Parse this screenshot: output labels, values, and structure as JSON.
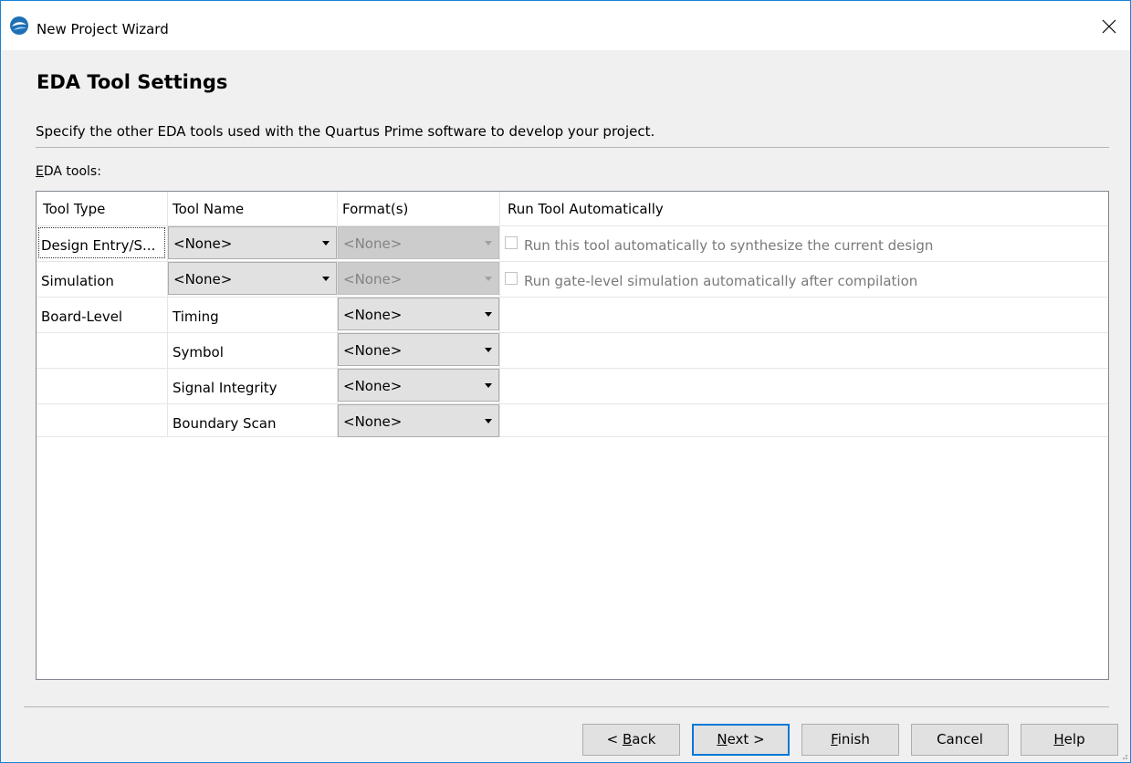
{
  "window": {
    "title": "New Project Wizard",
    "close_label": "Close"
  },
  "page": {
    "heading": "EDA Tool Settings",
    "description": "Specify the other EDA tools used with the Quartus Prime software to develop your project.",
    "eda_tools_label_mnemonic": "E",
    "eda_tools_label_rest": "DA tools:"
  },
  "table": {
    "headers": [
      "Tool Type",
      "Tool Name",
      "Format(s)",
      "Run Tool Automatically"
    ],
    "rows": [
      {
        "tool_type": "Design Entry/S...",
        "tool_name": "<None>",
        "tool_name_is_dropdown": true,
        "format": "<None>",
        "format_enabled": false,
        "run_label": "Run this tool automatically to synthesize the current design",
        "run_checked": false
      },
      {
        "tool_type": "Simulation",
        "tool_name": "<None>",
        "tool_name_is_dropdown": true,
        "format": "<None>",
        "format_enabled": false,
        "run_label": "Run gate-level simulation automatically after compilation",
        "run_checked": false
      },
      {
        "tool_type": "Board-Level",
        "tool_name": "Timing",
        "format": "<None>",
        "format_enabled": true
      },
      {
        "tool_type": "",
        "tool_name": "Symbol",
        "format": "<None>",
        "format_enabled": true
      },
      {
        "tool_type": "",
        "tool_name": "Signal Integrity",
        "format": "<None>",
        "format_enabled": true
      },
      {
        "tool_type": "",
        "tool_name": "Boundary Scan",
        "format": "<None>",
        "format_enabled": true
      }
    ]
  },
  "buttons": {
    "back_pre": "< ",
    "back_mn": "B",
    "back_post": "ack",
    "next_mn": "N",
    "next_post": "ext >",
    "finish_mn": "F",
    "finish_post": "inish",
    "cancel": "Cancel",
    "help_mn": "H",
    "help_post": "elp"
  },
  "colors": {
    "accent": "#0078d7",
    "window_border": "#1883d7",
    "app_icon": "#1f6fb5"
  }
}
